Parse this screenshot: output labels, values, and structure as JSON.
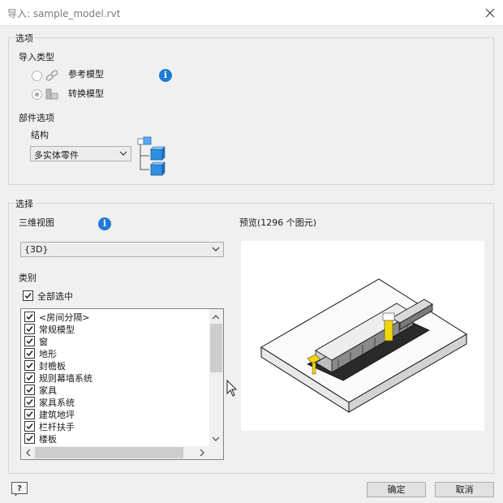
{
  "window": {
    "title": "导入: sample_model.rvt"
  },
  "options": {
    "group_label": "选项",
    "import_type_label": "导入类型",
    "radio_reference_label": "参考模型",
    "radio_convert_label": "转换模型",
    "component_options_label": "部件选项",
    "structure_label": "结构",
    "structure_value": "多实体零件"
  },
  "selection": {
    "group_label": "选择",
    "view3d_label": "三维视图",
    "view3d_value": "{3D}",
    "preview_label": "预览(1296 个图元)",
    "category_label": "类别",
    "select_all_label": "全部选中",
    "categories": [
      {
        "label": "<房间分隔>",
        "checked": true
      },
      {
        "label": "常规模型",
        "checked": true
      },
      {
        "label": "窗",
        "checked": true
      },
      {
        "label": "地形",
        "checked": true
      },
      {
        "label": "封檐板",
        "checked": true
      },
      {
        "label": "规则幕墙系统",
        "checked": true
      },
      {
        "label": "家具",
        "checked": true
      },
      {
        "label": "家具系统",
        "checked": true
      },
      {
        "label": "建筑地坪",
        "checked": true
      },
      {
        "label": "栏杆扶手",
        "checked": true
      },
      {
        "label": "楼板",
        "checked": true
      }
    ]
  },
  "footer": {
    "ok_label": "确定",
    "cancel_label": "取消"
  },
  "colors": {
    "info_blue": "#1f7bd6",
    "cube_blue": "#2f8fe0",
    "highlight_yellow": "#f2d600"
  }
}
